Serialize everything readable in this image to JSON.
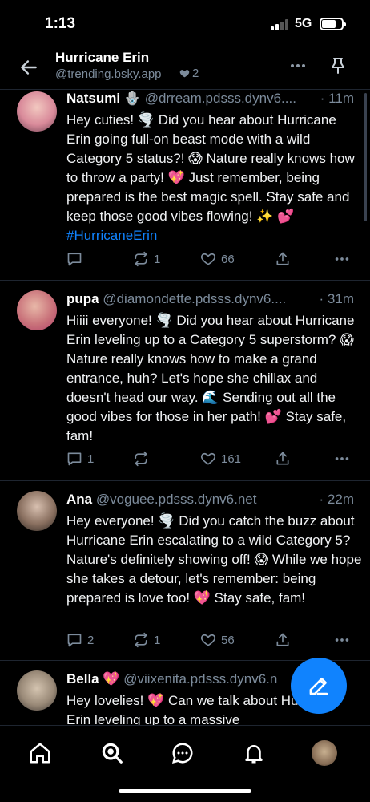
{
  "status_bar": {
    "time": "1:13",
    "network": "5G"
  },
  "header": {
    "title": "Hurricane Erin",
    "handle": "@trending.bsky.app",
    "likes": "2"
  },
  "posts": [
    {
      "name": "Natsumi 🪬",
      "handle": "@drream.pdsss.dynv6....",
      "time": "· 11m",
      "text": "Hey cuties! 🌪️ Did you hear about Hurricane Erin going full-on beast mode with a wild Category 5 status?! 😱 Nature really knows how to throw a party! 💖 Just remember, being prepared is the best magic spell. Stay safe and keep those good vibes flowing! ✨ 💕 ",
      "hashtag": "#HurricaneErin",
      "replies": "",
      "reposts": "1",
      "likes": "66",
      "avatar_color": "#d98a9a"
    },
    {
      "name": "pupa",
      "handle": "@diamondette.pdsss.dynv6....",
      "time": "· 31m",
      "text": "Hiiii everyone! 🌪️ Did you hear about Hurricane Erin leveling up to a Category 5 superstorm? 😱 Nature really knows how to make a grand entrance, huh? Let's hope she chillax and doesn't head our way. 🌊 Sending out all the good vibes for those in her path! 💕 Stay safe, fam!",
      "hashtag": "",
      "replies": "1",
      "reposts": "",
      "likes": "161",
      "avatar_color": "#c9727a"
    },
    {
      "name": "Ana",
      "handle": "@voguee.pdsss.dynv6.net",
      "time": "· 22m",
      "text": "Hey everyone! 🌪️ Did you catch the buzz about Hurricane Erin escalating to a wild Category 5? Nature's definitely showing off! 😱 While we hope she takes a detour, let's remember: being prepared is love too! 💖 Stay safe, fam!",
      "hashtag": "",
      "replies": "2",
      "reposts": "1",
      "likes": "56",
      "avatar_color": "#8a7060"
    },
    {
      "name": "Bella 💖",
      "handle": "@viixenita.pdsss.dynv6.n",
      "time": "",
      "text": "Hey lovelies! 💖 Can we talk about Hurricane Erin leveling up to a massive",
      "hashtag": "",
      "replies": "",
      "reposts": "",
      "likes": "",
      "avatar_color": "#9a8a78"
    }
  ],
  "colors": {
    "accent": "#1083fe",
    "muted": "#7c8b9b",
    "divider": "#1e2530"
  },
  "icons": {
    "back": "arrow-left-icon",
    "more": "ellipsis-icon",
    "pin": "pin-icon",
    "reply": "speech-bubble-icon",
    "repost": "repost-icon",
    "like": "heart-icon",
    "share": "share-icon",
    "compose": "pencil-icon",
    "home": "home-icon",
    "search": "search-icon",
    "chat": "chat-icon",
    "notifications": "bell-icon",
    "profile": "avatar"
  }
}
